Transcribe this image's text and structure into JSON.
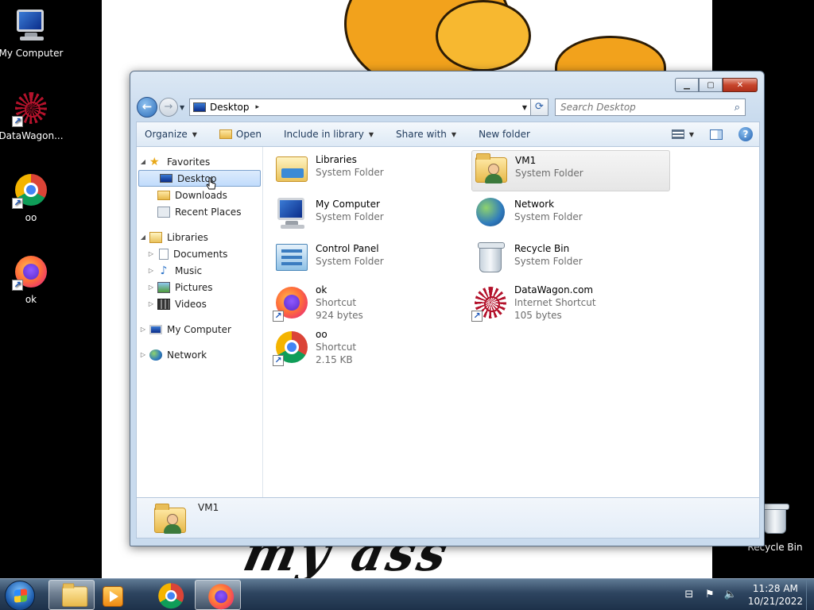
{
  "wallpaper": {
    "caption": "my ass"
  },
  "desktop": {
    "icons": [
      {
        "label": "My Computer",
        "icon": "my-computer-icon"
      },
      {
        "label": "DataWagon...",
        "icon": "datawagon-icon"
      },
      {
        "label": "oo",
        "icon": "chrome-icon"
      },
      {
        "label": "ok",
        "icon": "firefox-icon"
      },
      {
        "label": "Recycle Bin",
        "icon": "recycle-bin-icon"
      }
    ]
  },
  "window": {
    "controls": {
      "minimize": "▁",
      "maximize": "▢",
      "close": "✕"
    },
    "address": {
      "location": "Desktop",
      "separator": "▸"
    },
    "search": {
      "placeholder": "Search Desktop"
    },
    "commandbar": {
      "organize": "Organize",
      "open": "Open",
      "include_in_library": "Include in library",
      "share_with": "Share with",
      "new_folder": "New folder"
    },
    "navpane": {
      "favorites": "Favorites",
      "desktop": "Desktop",
      "downloads": "Downloads",
      "recent_places": "Recent Places",
      "libraries": "Libraries",
      "documents": "Documents",
      "music": "Music",
      "pictures": "Pictures",
      "videos": "Videos",
      "my_computer": "My Computer",
      "network": "Network"
    },
    "items": [
      {
        "name": "Libraries",
        "type": "System Folder",
        "icon": "libraries-icon"
      },
      {
        "name": "VM1",
        "type": "System Folder",
        "icon": "user-folder-icon",
        "selected": true
      },
      {
        "name": "My Computer",
        "type": "System Folder",
        "icon": "my-computer-icon"
      },
      {
        "name": "Network",
        "type": "System Folder",
        "icon": "network-icon"
      },
      {
        "name": "Control Panel",
        "type": "System Folder",
        "icon": "control-panel-icon"
      },
      {
        "name": "Recycle Bin",
        "type": "System Folder",
        "icon": "recycle-bin-icon"
      },
      {
        "name": "ok",
        "type": "Shortcut",
        "size": "924 bytes",
        "icon": "firefox-icon"
      },
      {
        "name": "DataWagon.com",
        "type": "Internet Shortcut",
        "size": "105 bytes",
        "icon": "datawagon-icon"
      },
      {
        "name": "oo",
        "type": "Shortcut",
        "size": "2.15 KB",
        "icon": "chrome-icon"
      }
    ],
    "details": {
      "name": "VM1"
    }
  },
  "taskbar": {
    "clock_time": "11:28 AM",
    "clock_date": "10/21/2022"
  }
}
